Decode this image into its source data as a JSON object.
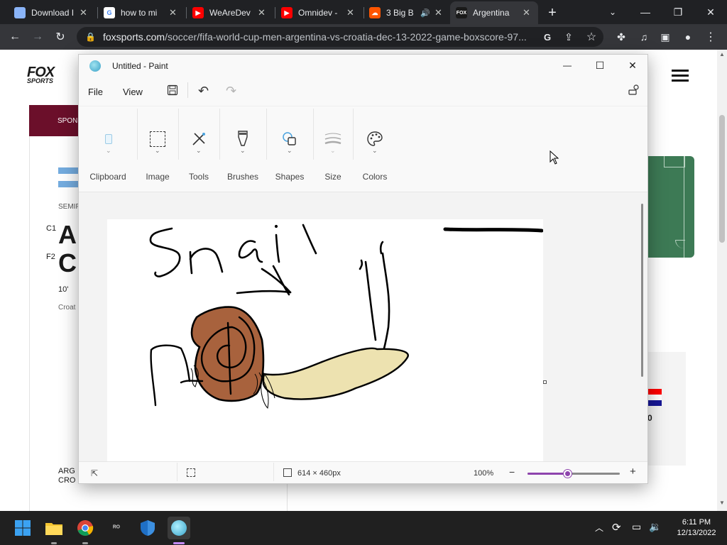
{
  "browser": {
    "tabs": [
      {
        "title": "Download I",
        "icon": "generic-page-icon",
        "color": "#5f6368"
      },
      {
        "title": "how to mi",
        "icon": "google-icon",
        "color": "#ffffff"
      },
      {
        "title": "WeAreDev",
        "icon": "youtube-icon",
        "color": "#ff0000"
      },
      {
        "title": "Omnidev -",
        "icon": "youtube-icon",
        "color": "#ff0000"
      },
      {
        "title": "3 Big B",
        "icon": "soundcloud-icon",
        "color": "#ff5500"
      },
      {
        "title": "Argentina",
        "icon": "foxsports-icon",
        "color": "#1a1a1a"
      }
    ],
    "url_domain": "foxsports.com",
    "url_path": "/soccer/fifa-world-cup-men-argentina-vs-croatia-dec-13-2022-game-boxscore-97..."
  },
  "site": {
    "logo_top": "FOX",
    "logo_bottom": "SPORTS",
    "sponsor": "SPONS",
    "round": "SEMIF",
    "team1_code": "C1",
    "team1_name": "AR",
    "team2_code": "F2",
    "team2_name": "CR",
    "minute": "10'",
    "team2_full": "Croat",
    "score_digit": "0",
    "bottom_team1": "ARG",
    "bottom_team2": "CRO"
  },
  "paint": {
    "title": "Untitled - Paint",
    "menu": {
      "file": "File",
      "view": "View"
    },
    "ribbon": [
      {
        "label": "Clipboard",
        "icon": "clipboard-icon"
      },
      {
        "label": "Image",
        "icon": "selection-icon"
      },
      {
        "label": "Tools",
        "icon": "tools-icon"
      },
      {
        "label": "Brushes",
        "icon": "brush-icon"
      },
      {
        "label": "Shapes",
        "icon": "shapes-icon"
      },
      {
        "label": "Size",
        "icon": "size-icon"
      },
      {
        "label": "Colors",
        "icon": "palette-icon"
      }
    ],
    "canvas_text": "Snail",
    "status": {
      "dimensions": "614 × 460px",
      "zoom": "100%",
      "zoom_fraction": 0.44
    },
    "colors": {
      "snail_shell": "#a8623d",
      "snail_body": "#ede2b0",
      "zoom_accent": "#8e44ad"
    }
  },
  "taskbar": {
    "time": "6:11 PM",
    "date": "12/13/2022"
  }
}
